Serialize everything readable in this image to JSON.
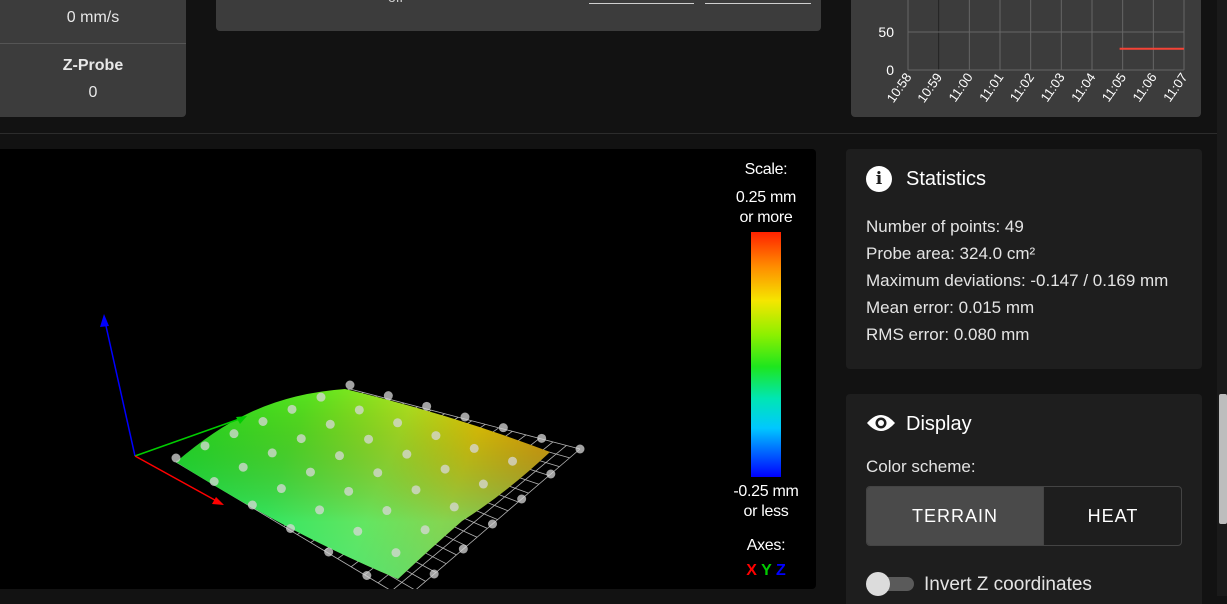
{
  "sensors": {
    "speed_value": "0 mm/s",
    "zprobe_label": "Z-Probe",
    "zprobe_value": "0"
  },
  "fan": {
    "state": "off"
  },
  "temp_chart": {
    "y_ticks": [
      "50",
      "0"
    ],
    "x_ticks": [
      "10:58",
      "10:59",
      "11:00",
      "11:01",
      "11:02",
      "11:03",
      "11:04",
      "11:05",
      "11:06",
      "11:07"
    ],
    "series_color": "#f44336"
  },
  "chart_data": {
    "type": "line",
    "x": [
      "10:58",
      "10:59",
      "11:00",
      "11:01",
      "11:02",
      "11:03",
      "11:04",
      "11:05",
      "11:06",
      "11:07"
    ],
    "y_ticks": [
      0,
      50
    ],
    "series": [
      {
        "x": [
          "11:04.9",
          "11:07"
        ],
        "values": [
          28,
          28
        ],
        "color": "#f44336"
      }
    ]
  },
  "heightmap": {
    "scale_title": "Scale:",
    "scale_max_line1": "0.25 mm",
    "scale_max_line2": "or more",
    "scale_min_line1": "-0.25 mm",
    "scale_min_line2": "or less",
    "axes_title": "Axes:",
    "axis_x": "X",
    "axis_y": "Y",
    "axis_z": "Z",
    "axis_colors": {
      "x": "#ff0000",
      "y": "#00cc00",
      "z": "#0000ff"
    }
  },
  "statistics": {
    "title": "Statistics",
    "points": "Number of points: 49",
    "area": "Probe area: 324.0 cm²",
    "deviations": "Maximum deviations: -0.147 / 0.169 mm",
    "mean": "Mean error: 0.015 mm",
    "rms": "RMS error: 0.080 mm"
  },
  "display": {
    "title": "Display",
    "color_scheme_label": "Color scheme:",
    "terrain": "TERRAIN",
    "heat": "HEAT",
    "invert_label": "Invert Z coordinates"
  }
}
